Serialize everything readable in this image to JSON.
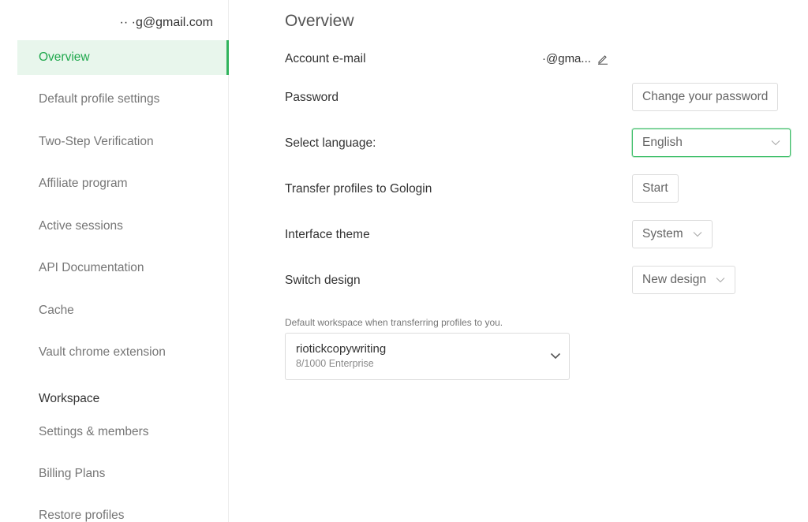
{
  "sidebar": {
    "account_email": "·· ·g@gmail.com",
    "items": [
      {
        "label": "Overview"
      },
      {
        "label": "Default profile settings"
      },
      {
        "label": "Two-Step Verification"
      },
      {
        "label": "Affiliate program"
      },
      {
        "label": "Active sessions"
      },
      {
        "label": "API Documentation"
      },
      {
        "label": "Cache"
      },
      {
        "label": "Vault chrome extension"
      }
    ],
    "workspace_heading": "Workspace",
    "workspace_items": [
      {
        "label": "Settings & members"
      },
      {
        "label": "Billing Plans"
      },
      {
        "label": "Restore profiles"
      }
    ]
  },
  "main": {
    "title": "Overview",
    "account_email": {
      "label": "Account e-mail",
      "value": "·@gma..."
    },
    "password": {
      "label": "Password",
      "button": "Change your password"
    },
    "language": {
      "label": "Select language:",
      "value": "English"
    },
    "transfer": {
      "label": "Transfer profiles to Gologin",
      "button": "Start"
    },
    "theme": {
      "label": "Interface theme",
      "value": "System"
    },
    "design": {
      "label": "Switch design",
      "value": "New design"
    },
    "workspace": {
      "hint": "Default workspace when transferring profiles to you.",
      "name": "riotickcopywriting",
      "meta": "8/1000 Enterprise"
    }
  },
  "colors": {
    "accent": "#31b45d",
    "active_bg": "#e8f6ec",
    "border": "#dcdcdc"
  },
  "icons": [
    "edit-pencil-icon",
    "chevron-down-icon"
  ]
}
